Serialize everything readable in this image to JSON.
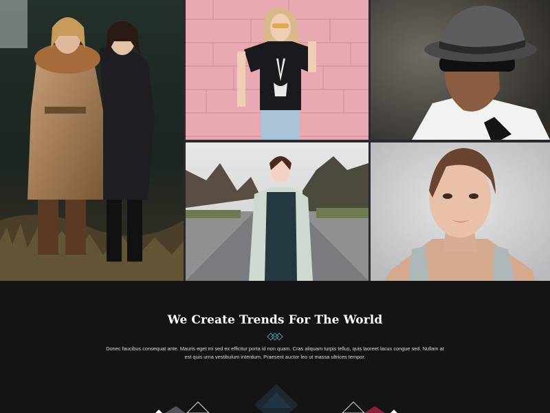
{
  "gallery": {
    "photos": [
      {
        "subject": "two women in winter coats in a forest"
      },
      {
        "subject": "blonde woman in skeleton t-shirt against pink wall"
      },
      {
        "subject": "man in grey fedora and sunglasses"
      },
      {
        "subject": "woman in light coat on a road"
      },
      {
        "subject": "young woman portrait on grey background"
      }
    ]
  },
  "intro": {
    "heading": "We Create Trends For The World",
    "body": "Donec faucibus consequat ante. Mauris eget mi sed ex efficitur porta id non quam. Cras aliquam turpis tellus, quis laoreet lacus congue sed. Nullam at est quis urna vestibulum interdum. Praesent auctor leo ut massa ultrices tempor.",
    "divider_icon": "diamond-divider-icon"
  },
  "colors": {
    "page_bg": "#141316",
    "heading": "#ffffff",
    "body_text": "#d8d8dc",
    "accent_divider": "#4a8a9a"
  }
}
